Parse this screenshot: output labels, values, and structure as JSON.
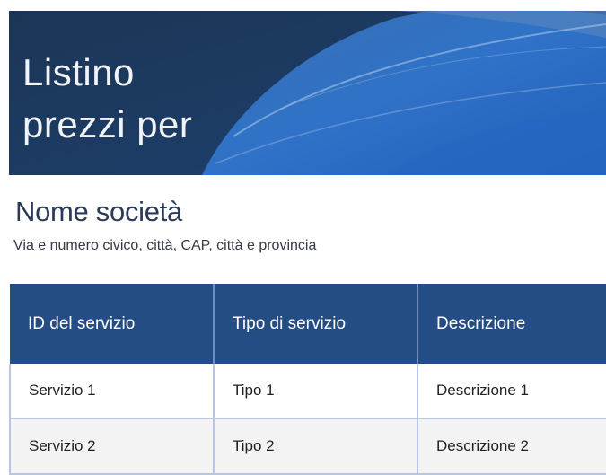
{
  "banner": {
    "title_line1": "Listino",
    "title_line2": "prezzi per"
  },
  "company": {
    "name": "Nome società",
    "address": "Via e numero civico, città, CAP, città e provincia"
  },
  "table": {
    "headers": [
      "ID del servizio",
      "Tipo di servizio",
      "Descrizione"
    ],
    "rows": [
      [
        "Servizio 1",
        "Tipo 1",
        "Descrizione 1"
      ],
      [
        "Servizio 2",
        "Tipo 2",
        "Descrizione 2"
      ]
    ]
  },
  "colors": {
    "banner_dark": "#1d3a5c",
    "banner_blue": "#2f6fc4",
    "header_blue": "#244d86",
    "company_text": "#2b3a57"
  }
}
